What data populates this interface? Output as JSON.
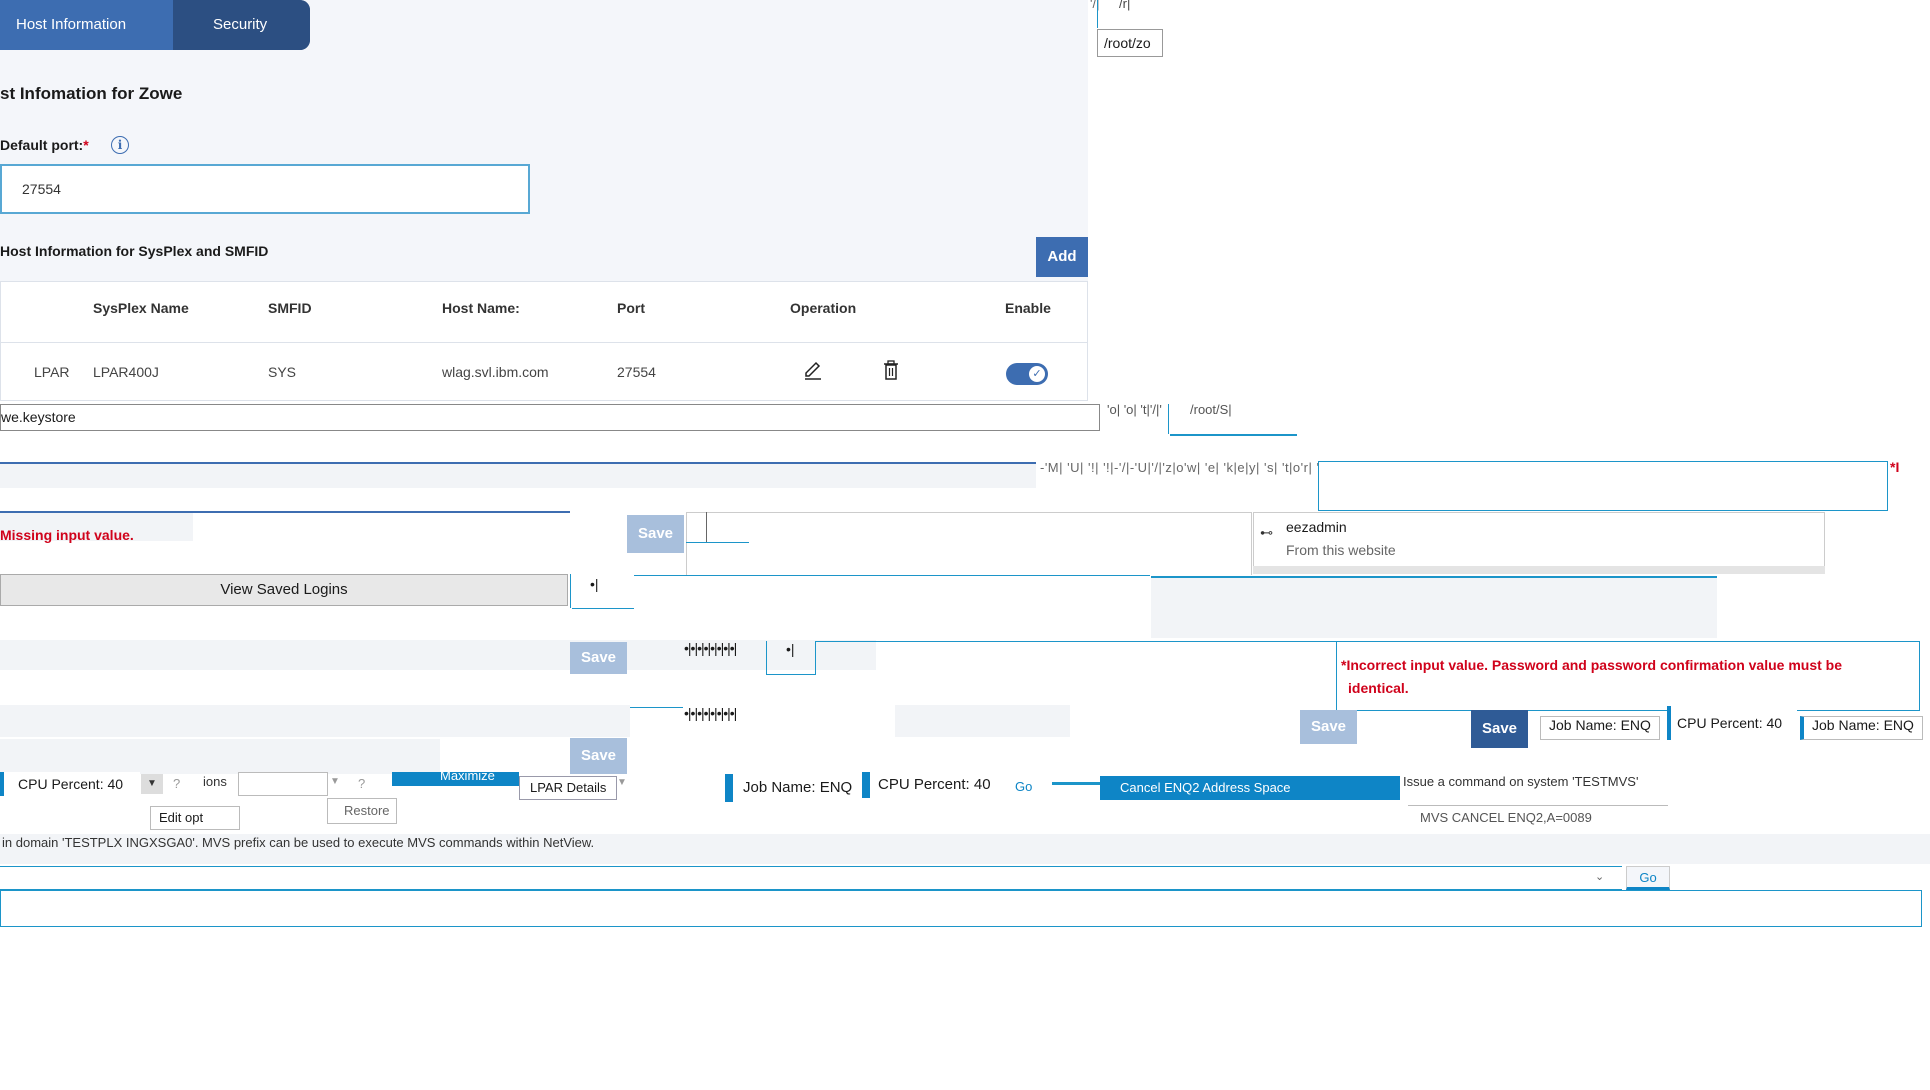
{
  "tabs": [
    {
      "label": "Host Information"
    },
    {
      "label": "Security"
    }
  ],
  "page_title": "st Infomation for Zowe",
  "default_port": {
    "label": "Default port:",
    "required_mark": "*",
    "value": "27554"
  },
  "sysplex_section": {
    "title": "Host Information for SysPlex and SMFID",
    "add_label": "Add"
  },
  "table": {
    "headers": [
      "SysPlex Name",
      "SMFID",
      "Host Name:",
      "Port",
      "Operation",
      "Enable"
    ],
    "row": {
      "type": "LPAR",
      "sysplex": "LPAR400J",
      "smfid": "SYS",
      "host": "wlag.svl.ibm.com",
      "port": "27554"
    }
  },
  "fragments": {
    "top_r": "/r|",
    "top_slash": "'/|",
    "root_zo": "/root/zo",
    "keystore": "we.keystore",
    "garbled1": "'o| 'o| 't|'/|'",
    "root_s": "/root/S|",
    "garbled2": "-'M| 'U| '!| '!|-'/|-'U|'/|'z|o'w| 'e| 'k|e|y| 's| 't|o'r| 'e",
    "req_star_i": "*I",
    "missing_input": "Missing input value.",
    "saved_user": "eezadmin",
    "saved_from": "From this website",
    "view_saved": "View Saved Logins",
    "dot1": "•|",
    "dots_row1": "•|•|•|•|•|•|•|•|",
    "dot2": "•|",
    "incorrect_msg_line1": "*Incorrect input value. Password and password confirmation value must be",
    "incorrect_msg_line2": "identical.",
    "dots_row2": "•|•|•|•|•|•|•|•|",
    "save": "Save",
    "job_name": "Job Name: ENQ",
    "cpu_percent": "CPU Percent: 40",
    "help_q": "?",
    "ions": "ions",
    "edit_opt": "Edit opt",
    "maximize": "Maximize",
    "lpar_details": "LPAR Details",
    "restore": "Restore",
    "go": "Go",
    "cancel_enq": "Cancel ENQ2 Address Space",
    "issue_cmd": "Issue a command on system 'TESTMVS'",
    "mvs_cancel": "MVS CANCEL ENQ2,A=0089",
    "domain_note": "in domain 'TESTPLX INGXSGA0'. MVS prefix can be used to execute MVS commands within NetView."
  },
  "colors": {
    "primary": "#3d6db1",
    "tab_dark": "#2c4f82",
    "error": "#d0021b",
    "teal": "#1c95c9"
  }
}
